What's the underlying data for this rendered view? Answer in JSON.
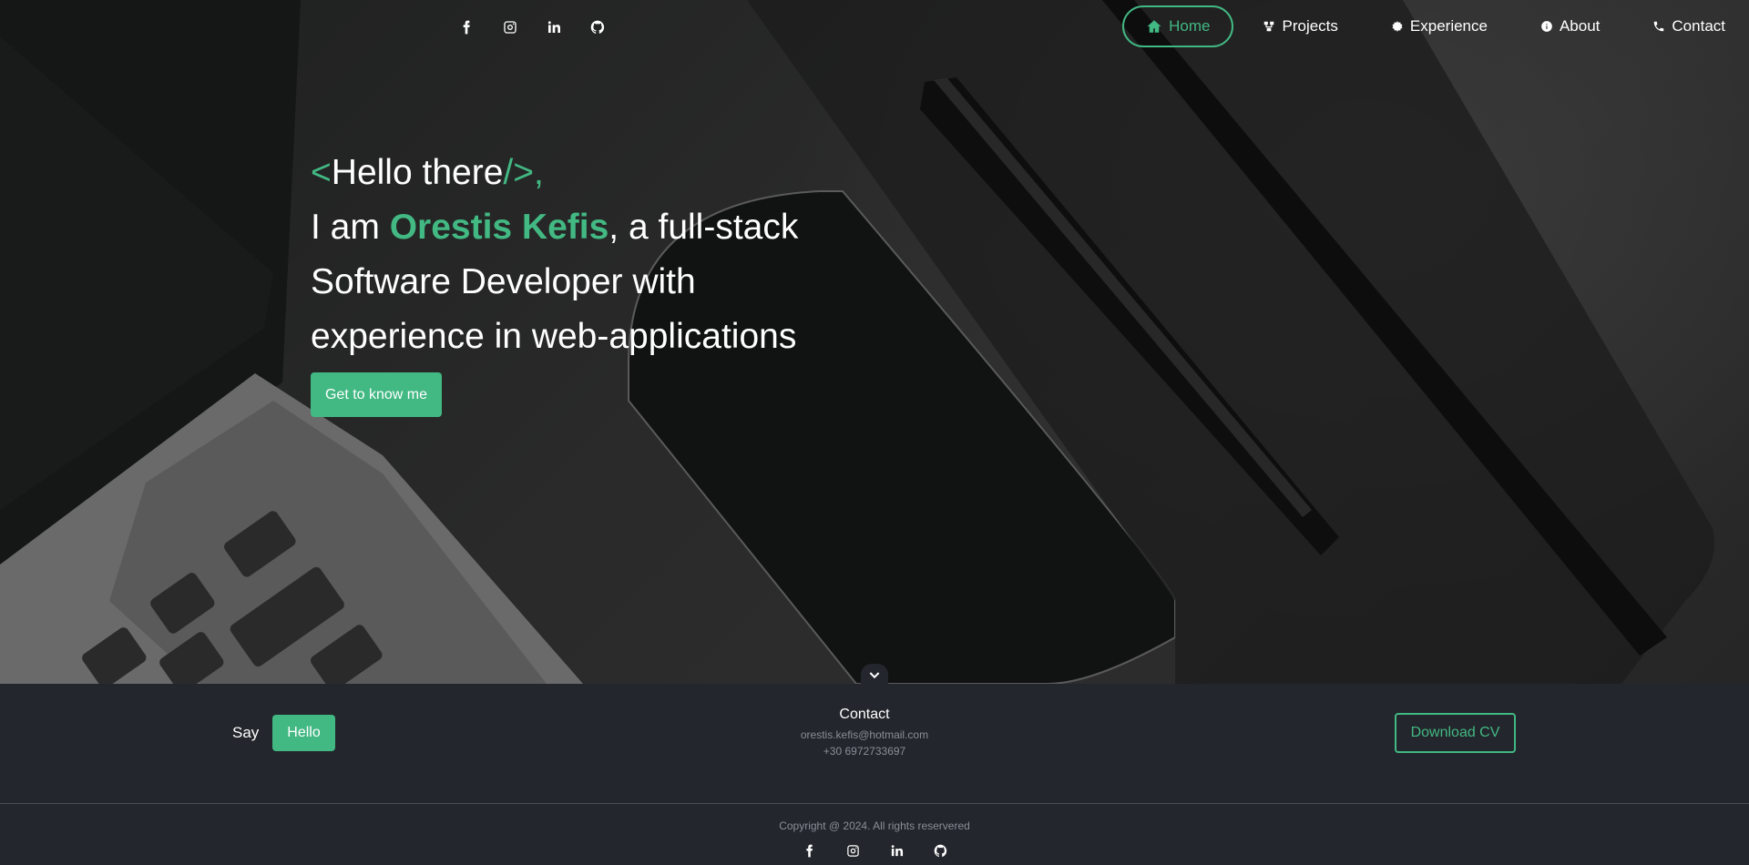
{
  "nav": {
    "social": [
      {
        "name": "facebook-icon"
      },
      {
        "name": "instagram-icon"
      },
      {
        "name": "linkedin-icon"
      },
      {
        "name": "github-icon"
      }
    ],
    "items": [
      {
        "label": "Home",
        "icon": "home-icon",
        "active": true
      },
      {
        "label": "Projects",
        "icon": "projects-icon",
        "active": false
      },
      {
        "label": "Experience",
        "icon": "experience-icon",
        "active": false
      },
      {
        "label": "About",
        "icon": "info-icon",
        "active": false
      },
      {
        "label": "Contact",
        "icon": "phone-icon",
        "active": false
      }
    ]
  },
  "hero": {
    "open_tag": "<",
    "greeting": "Hello there",
    "close_tag": "/>,",
    "intro_prefix": "I am ",
    "name": "Orestis Kefis",
    "intro_suffix": ", a full-stack Software Developer with experience in web-applications",
    "cta_label": "Get to know me"
  },
  "footer": {
    "say_label": "Say",
    "hello_label": "Hello",
    "contact_title": "Contact",
    "email": "orestis.kefis@hotmail.com",
    "phone": "+30 6972733697",
    "cv_label": "Download CV",
    "copyright": "Copyright @ 2024. All rights reservered"
  },
  "colors": {
    "accent": "#42b883",
    "footer_bg": "#23262c",
    "muted_text": "#8a8e96"
  }
}
